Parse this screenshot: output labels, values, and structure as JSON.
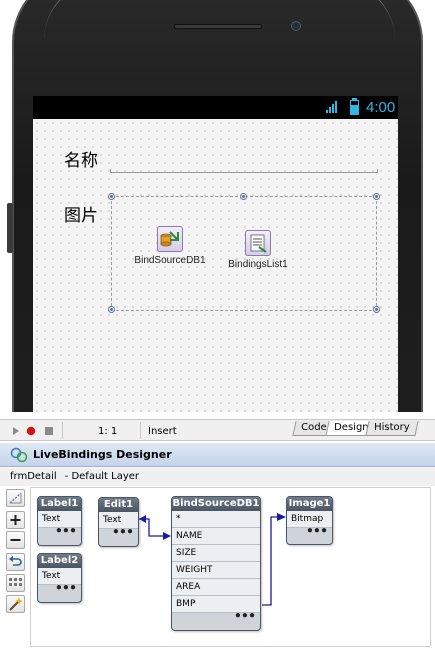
{
  "form": {
    "status_time": "4:00",
    "name_label": "名称",
    "picture_label": "图片",
    "components": [
      {
        "label": "BindSourceDB1",
        "icon": "bind-source-db-icon"
      },
      {
        "label": "BindingsList1",
        "icon": "bindings-list-icon"
      }
    ]
  },
  "editor_bar": {
    "cursor_pos": "1:   1",
    "mode": "Insert",
    "tabs": [
      "Code",
      "Design",
      "History"
    ],
    "active_tab": "Design"
  },
  "live_bindings": {
    "title": "LiveBindings Designer",
    "form_name": "frmDetail",
    "layer": "- Default Layer",
    "toolbar": [
      "zoom-to-fit-icon",
      "zoom-in-icon",
      "zoom-out-icon",
      "undo-icon",
      "arrange-grid-icon",
      "wizard-icon"
    ],
    "boxes": {
      "label1": {
        "title": "Label1",
        "members": [
          "Text"
        ]
      },
      "label2": {
        "title": "Label2",
        "members": [
          "Text"
        ]
      },
      "edit1": {
        "title": "Edit1",
        "members": [
          "Text"
        ]
      },
      "bindsource": {
        "title": "BindSourceDB1",
        "members": [
          "*",
          "NAME",
          "SIZE",
          "WEIGHT",
          "AREA",
          "BMP"
        ]
      },
      "image1": {
        "title": "Image1",
        "members": [
          "Bitmap"
        ]
      }
    },
    "footer_dots": "●●●",
    "link_color": "#1a1aa8"
  }
}
